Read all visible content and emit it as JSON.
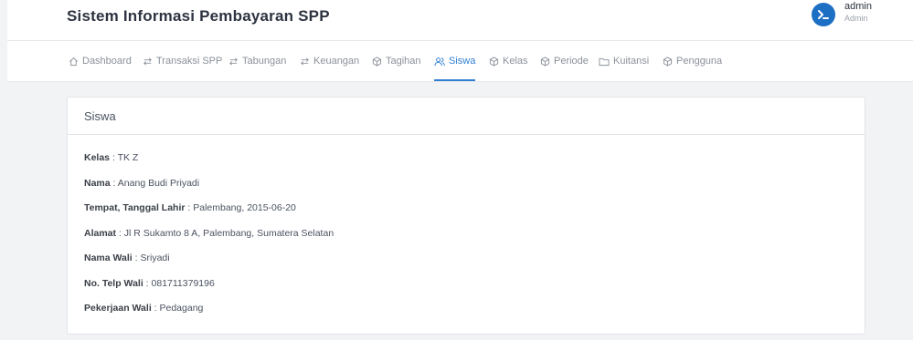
{
  "app": {
    "title": "Sistem Informasi Pembayaran SPP"
  },
  "user": {
    "name": "admin",
    "role": "Admin",
    "avatar_color": "#1d6fc4"
  },
  "nav": {
    "active_color": "#2f7fd3",
    "items": [
      {
        "label": "Dashboard",
        "icon": "home-icon"
      },
      {
        "label": "Transaksi SPP",
        "icon": "swap-icon"
      },
      {
        "label": "Tabungan",
        "icon": "swap-icon"
      },
      {
        "label": "Keuangan",
        "icon": "swap-icon"
      },
      {
        "label": "Tagihan",
        "icon": "cube-icon"
      },
      {
        "label": "Siswa",
        "icon": "users-icon",
        "active": true
      },
      {
        "label": "Kelas",
        "icon": "cube-icon"
      },
      {
        "label": "Periode",
        "icon": "cube-icon"
      },
      {
        "label": "Kuitansi",
        "icon": "folder-icon"
      },
      {
        "label": "Pengguna",
        "icon": "cube-icon"
      }
    ]
  },
  "card": {
    "title": "Siswa",
    "fields": [
      {
        "label": "Kelas",
        "value": "TK Z"
      },
      {
        "label": "Nama",
        "value": "Anang Budi Priyadi"
      },
      {
        "label": "Tempat, Tanggal Lahir",
        "value": "Palembang, 2015-06-20"
      },
      {
        "label": "Alamat",
        "value": "Jl R Sukamto 8 A, Palembang, Sumatera Selatan"
      },
      {
        "label": "Nama Wali",
        "value": "Sriyadi"
      },
      {
        "label": "No. Telp Wali",
        "value": "081711379196"
      },
      {
        "label": "Pekerjaan Wali",
        "value": "Pedagang"
      }
    ]
  }
}
